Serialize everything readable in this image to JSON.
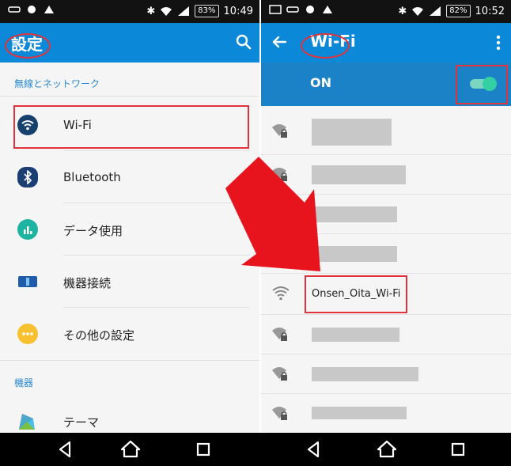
{
  "left": {
    "status": {
      "time": "10:49",
      "battery": "83%"
    },
    "title": "設定",
    "sections": [
      {
        "label": "無線とネットワーク"
      },
      {
        "label": "機器"
      }
    ],
    "items": [
      {
        "label": "Wi-Fi",
        "icon": "wifi-icon"
      },
      {
        "label": "Bluetooth",
        "icon": "bluetooth-icon"
      },
      {
        "label": "データ使用",
        "icon": "data-usage-icon"
      },
      {
        "label": "機器接続",
        "icon": "device-connection-icon"
      },
      {
        "label": "その他の設定",
        "icon": "more-settings-icon"
      },
      {
        "label": "テーマ",
        "icon": "theme-icon"
      }
    ]
  },
  "right": {
    "status": {
      "time": "10:52",
      "battery": "82%"
    },
    "title": "Wi-Fi",
    "on_label": "ON",
    "network_name": "Onsen_Oita_Wi-Fi"
  },
  "colors": {
    "app_bar": "#0b88d8",
    "highlight": "#e1333b",
    "arrow": "#e8141d",
    "toggle": "#33d0a4"
  }
}
